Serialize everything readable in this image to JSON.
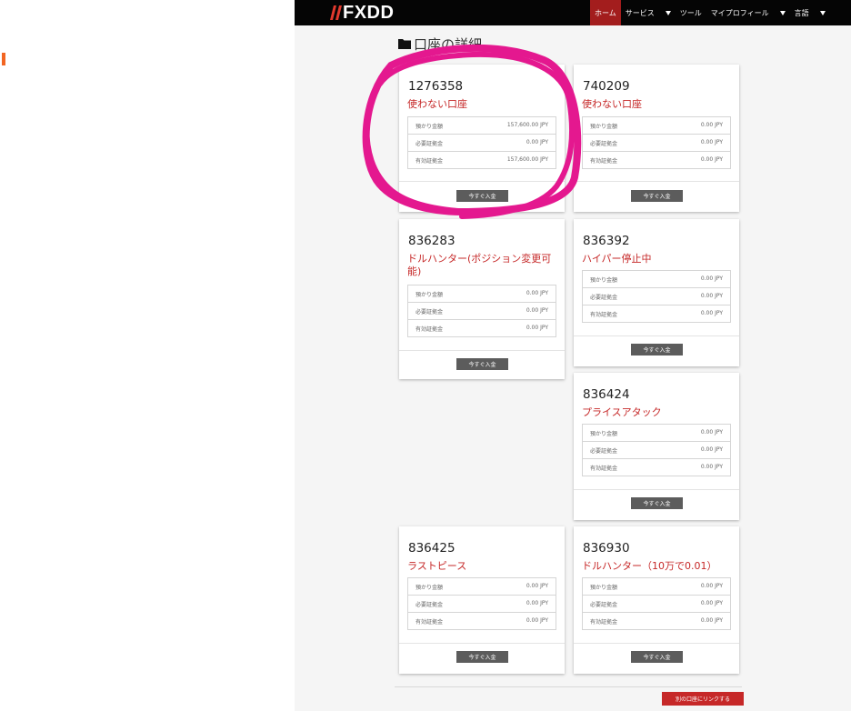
{
  "header": {
    "logo_text": "FXDD",
    "nav": [
      {
        "label": "ホーム",
        "active": true
      },
      {
        "label": "サービス",
        "dropdown": true
      },
      {
        "label": "ツール"
      },
      {
        "label": "マイプロフィール",
        "dropdown": true
      },
      {
        "label": "言語",
        "dropdown": true
      }
    ]
  },
  "page": {
    "title": "口座の詳細",
    "link_button": "別の口座にリンクする"
  },
  "accounts": [
    {
      "number": "1276358",
      "name": "使わない口座",
      "rows": [
        {
          "label": "預かり金額",
          "value": "157,600.00 JPY"
        },
        {
          "label": "必要証拠金",
          "value": "0.00 JPY"
        },
        {
          "label": "有効証拠金",
          "value": "157,600.00 JPY"
        }
      ],
      "deposit_label": "今すぐ入金"
    },
    {
      "number": "740209",
      "name": "使わない口座",
      "rows": [
        {
          "label": "預かり金額",
          "value": "0.00 JPY"
        },
        {
          "label": "必要証拠金",
          "value": "0.00 JPY"
        },
        {
          "label": "有効証拠金",
          "value": "0.00 JPY"
        }
      ],
      "deposit_label": "今すぐ入金"
    },
    {
      "number": "836283",
      "name": "ドルハンター(ポジション変更可能)",
      "rows": [
        {
          "label": "預かり金額",
          "value": "0.00 JPY"
        },
        {
          "label": "必要証拠金",
          "value": "0.00 JPY"
        },
        {
          "label": "有効証拠金",
          "value": "0.00 JPY"
        }
      ],
      "deposit_label": "今すぐ入金"
    },
    {
      "number": "836392",
      "name": "ハイパー停止中",
      "rows": [
        {
          "label": "預かり金額",
          "value": "0.00 JPY"
        },
        {
          "label": "必要証拠金",
          "value": "0.00 JPY"
        },
        {
          "label": "有効証拠金",
          "value": "0.00 JPY"
        }
      ],
      "deposit_label": "今すぐ入金"
    },
    {
      "number": "836424",
      "name": "プライスアタック",
      "rows": [
        {
          "label": "預かり金額",
          "value": "0.00 JPY"
        },
        {
          "label": "必要証拠金",
          "value": "0.00 JPY"
        },
        {
          "label": "有効証拠金",
          "value": "0.00 JPY"
        }
      ],
      "deposit_label": "今すぐ入金"
    },
    {
      "number": "836425",
      "name": "ラストピース",
      "rows": [
        {
          "label": "預かり金額",
          "value": "0.00 JPY"
        },
        {
          "label": "必要証拠金",
          "value": "0.00 JPY"
        },
        {
          "label": "有効証拠金",
          "value": "0.00 JPY"
        }
      ],
      "deposit_label": "今すぐ入金"
    },
    {
      "number": "836930",
      "name": "ドルハンター（10万で0.01）",
      "rows": [
        {
          "label": "預かり金額",
          "value": "0.00 JPY"
        },
        {
          "label": "必要証拠金",
          "value": "0.00 JPY"
        },
        {
          "label": "有効証拠金",
          "value": "0.00 JPY"
        }
      ],
      "deposit_label": "今すぐ入金"
    }
  ],
  "colors": {
    "accent_red": "#c62828",
    "highlight_magenta": "#e4188f",
    "brand_orange": "#f26522"
  }
}
